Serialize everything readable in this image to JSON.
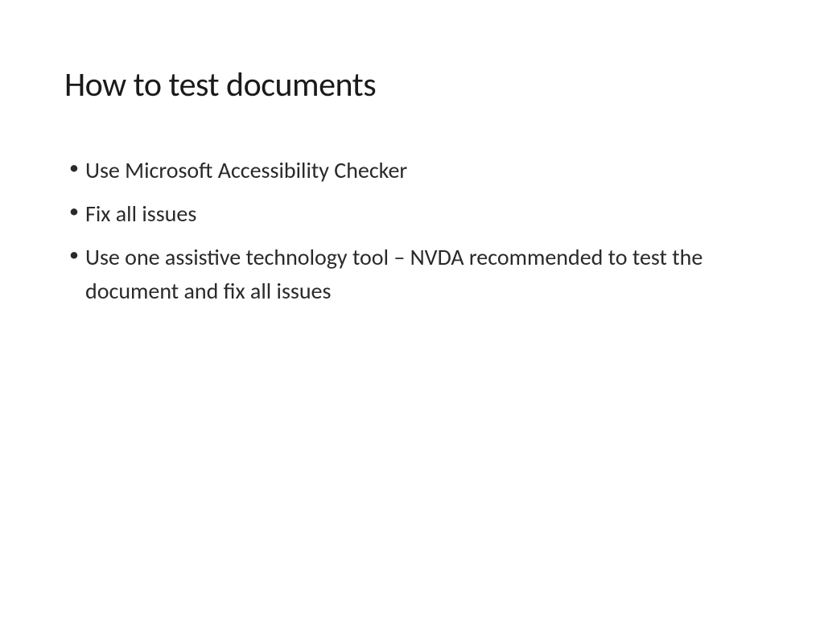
{
  "slide": {
    "title": "How to test documents",
    "bullets": [
      "Use Microsoft Accessibility Checker",
      "Fix all issues",
      "Use one assistive technology tool – NVDA recommended to test the document and fix all issues"
    ]
  }
}
